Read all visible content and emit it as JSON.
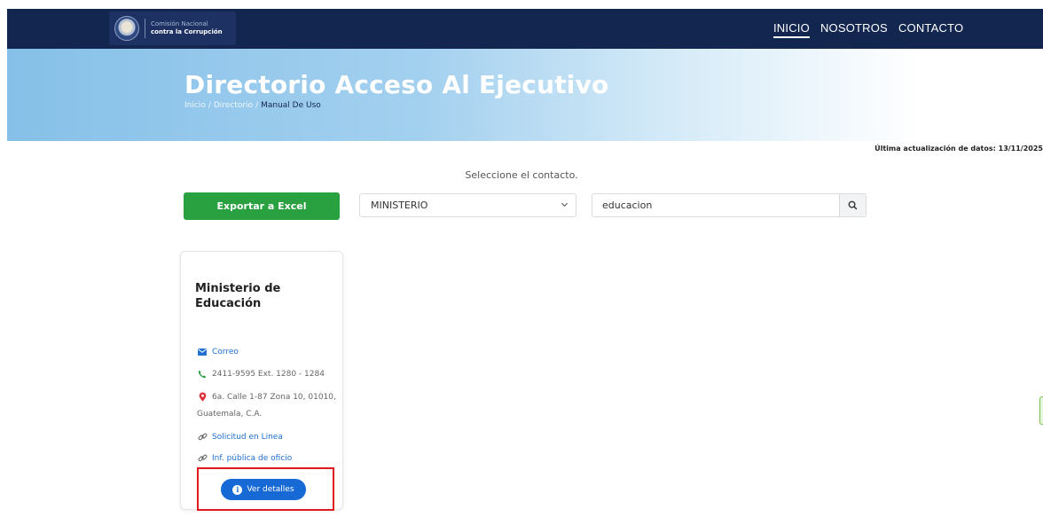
{
  "header": {
    "logo": {
      "line1": "Comisión Nacional",
      "line2": "contra la Corrupción"
    },
    "nav": [
      {
        "label": "INICIO",
        "active": true
      },
      {
        "label": "NOSOTROS",
        "active": false
      },
      {
        "label": "CONTACTO",
        "active": false
      }
    ]
  },
  "hero": {
    "title": "Directorio Acceso Al Ejecutivo",
    "breadcrumb": {
      "home": "Inicio",
      "sep": "/",
      "section": "Directorio",
      "current": "Manual De Uso"
    }
  },
  "last_update": "Última actualización de datos: 13/11/2025",
  "prompt": "Seleccione el contacto.",
  "controls": {
    "export_label": "Exportar a Excel",
    "filter_selected": "MINISTERIO",
    "search_value": "educacion"
  },
  "card": {
    "title": "Ministerio de Educación",
    "email_label": "Correo",
    "phone": "2411-9595 Ext. 1280 - 1284",
    "address_line1": "6a. Calle 1-87 Zona 10, 01010,",
    "address_line2": "Guatemala, C.A.",
    "request_label": "Solicitud en Linea",
    "public_info_label": "Inf. pública de oficio",
    "details_label": "Ver detalles"
  },
  "colors": {
    "navbar": "#13264f",
    "export_button": "#2aa141",
    "details_button": "#1769d6",
    "link": "#1f6fd1",
    "highlight": "#e0181f"
  }
}
